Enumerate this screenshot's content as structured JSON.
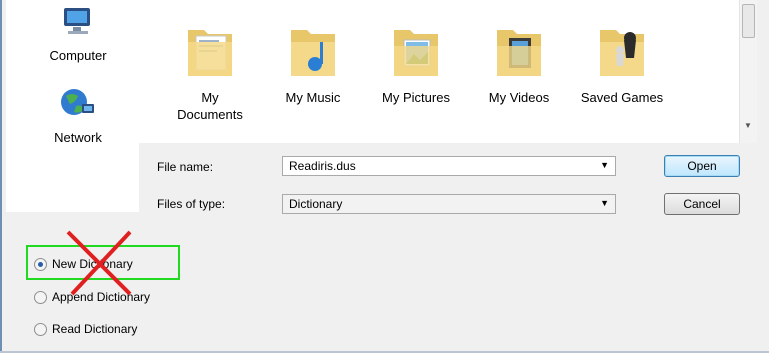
{
  "nav": {
    "items": [
      {
        "label": "Computer",
        "icon": "computer-icon"
      },
      {
        "label": "Network",
        "icon": "network-icon"
      }
    ]
  },
  "folders": [
    {
      "label_line1": "My",
      "label_line2": "Documents",
      "icon": "documents-folder-icon"
    },
    {
      "label_line1": "My Music",
      "label_line2": "",
      "icon": "music-folder-icon"
    },
    {
      "label_line1": "My Pictures",
      "label_line2": "",
      "icon": "pictures-folder-icon"
    },
    {
      "label_line1": "My Videos",
      "label_line2": "",
      "icon": "videos-folder-icon"
    },
    {
      "label_line1": "Saved Games",
      "label_line2": "",
      "icon": "saved-games-folder-icon"
    }
  ],
  "file_name": {
    "label": "File name:",
    "value": "Readiris.dus"
  },
  "file_type": {
    "label": "Files of type:",
    "value": "Dictionary"
  },
  "buttons": {
    "open": "Open",
    "cancel": "Cancel"
  },
  "options": [
    {
      "label": "New Dictionary",
      "selected": true
    },
    {
      "label": "Append Dictionary",
      "selected": false
    },
    {
      "label": "Read Dictionary",
      "selected": false
    }
  ],
  "colors": {
    "highlight_box": "#22d922",
    "cross_mark": "#e02020",
    "radio_selected": "#2a5da8"
  }
}
